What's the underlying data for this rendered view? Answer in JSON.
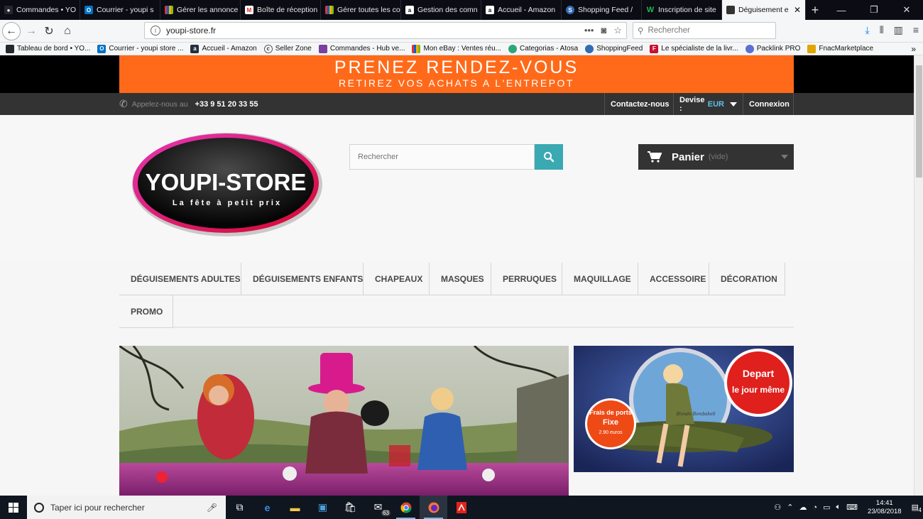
{
  "browser": {
    "tabs": [
      {
        "label": "Commandes • YO",
        "icon": "github-icon",
        "color": "#24292e"
      },
      {
        "label": "Courrier - youpi s",
        "icon": "outlook-icon",
        "color": "#0072c6"
      },
      {
        "label": "Gérer les annonce",
        "icon": "ebay-icon",
        "color": "#e53238"
      },
      {
        "label": "Boîte de réception",
        "icon": "gmail-icon",
        "color": "#d93025"
      },
      {
        "label": "Gérer toutes les co",
        "icon": "ebay-icon",
        "color": "#e53238"
      },
      {
        "label": "Gestion des comn",
        "icon": "amazon-icon",
        "color": "#232f3e"
      },
      {
        "label": "Accueil - Amazon",
        "icon": "amazon-icon",
        "color": "#232f3e"
      },
      {
        "label": "Shopping Feed /",
        "icon": "shoppingfeed-icon",
        "color": "#2f6db5"
      },
      {
        "label": "Inscription de site",
        "icon": "w-icon",
        "color": "#1db954"
      },
      {
        "label": "Déguisement e",
        "icon": "youpi-icon",
        "color": "#333333",
        "active": true
      }
    ],
    "new_tab_symbol": "+",
    "url": "youpi-store.fr",
    "search_placeholder": "Rechercher",
    "bookmarks": [
      {
        "label": "Tableau de bord • YO...",
        "color": "#24292e"
      },
      {
        "label": "Courrier - youpi store ...",
        "color": "#0072c6"
      },
      {
        "label": "Accueil - Amazon",
        "color": "#232f3e"
      },
      {
        "label": "Seller Zone",
        "color": "#555555"
      },
      {
        "label": "Commandes - Hub ve...",
        "color": "#7a3fa0"
      },
      {
        "label": "Mon eBay : Ventes réu...",
        "color": "#e53238"
      },
      {
        "label": "Categorias - Atosa",
        "color": "#2aa876"
      },
      {
        "label": "ShoppingFeed",
        "color": "#2f6db5"
      },
      {
        "label": "Le spécialiste de la livr...",
        "color": "#c8102e"
      },
      {
        "label": "Packlink PRO",
        "color": "#5b6fd6"
      },
      {
        "label": "FnacMarketplace",
        "color": "#e1a500"
      }
    ]
  },
  "site": {
    "banner_line1": "PRENEZ RENDEZ-VOUS",
    "banner_line2": "RETIREZ VOS ACHATS A L'ENTREPOT",
    "phone_label": "Appelez-nous au",
    "phone_number": "+33 9 51 20 33 55",
    "contact": "Contactez-nous",
    "currency_label": "Devise :",
    "currency_value": "EUR",
    "login": "Connexion",
    "logo_title": "YOUPI-STORE",
    "logo_tagline": "La fête à petit prix",
    "search_placeholder": "Rechercher",
    "cart_label": "Panier",
    "cart_status": "(vide)",
    "menu": [
      "DÉGUISEMENTS ADULTES",
      "DÉGUISEMENTS ENFANTS",
      "CHAPEAUX",
      "MASQUES",
      "PERRUQUES",
      "MAQUILLAGE",
      "ACCESSOIRE",
      "DÉCORATION",
      "PROMO"
    ],
    "side_banner": {
      "badge_top": "Depart le jour même",
      "badge_bottom_1": "Frais de ports",
      "badge_bottom_2": "Fixe",
      "badge_bottom_3": "2.90 euros",
      "signature": "Blonde Bombshell"
    },
    "accent_color": "#3aa9b1",
    "banner_color": "#ff6a1a"
  },
  "taskbar": {
    "search_placeholder": "Taper ici pour rechercher",
    "mail_badge": "63",
    "time": "14:41",
    "date": "23/08/2018",
    "notifications": "4"
  }
}
